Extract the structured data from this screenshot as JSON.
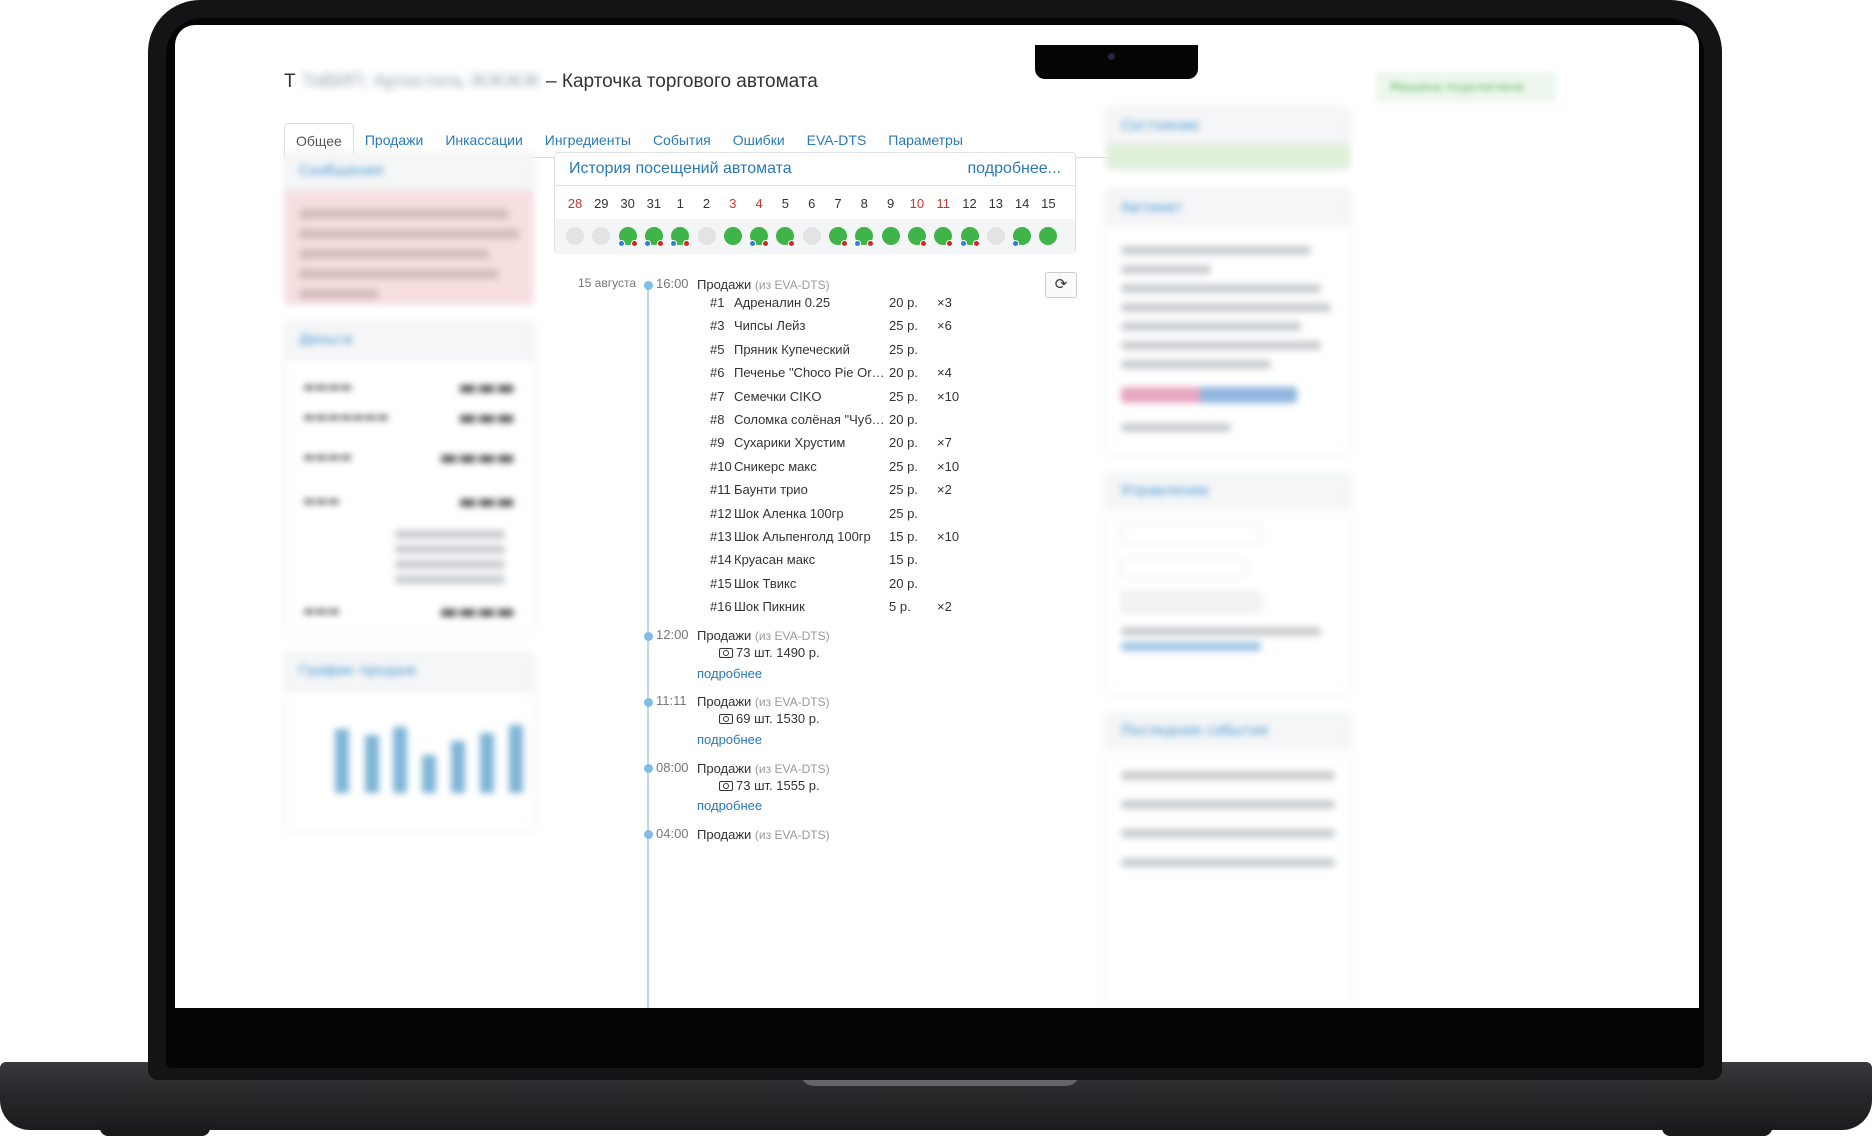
{
  "page": {
    "title_prefix": "Т",
    "title_obscured": "ТиВИП: Артистель ЖЖЖЖ",
    "title_suffix": "– Карточка торгового автомата",
    "header_button": "Машина подключена"
  },
  "tabs": [
    "Общее",
    "Продажи",
    "Инкассации",
    "Ингредиенты",
    "События",
    "Ошибки",
    "EVA-DTS",
    "Параметры"
  ],
  "history": {
    "title": "История посещений автомата",
    "more_link": "подробнее...",
    "days": [
      {
        "label": "28",
        "weekend": true,
        "state": "empty"
      },
      {
        "label": "29",
        "weekend": false,
        "state": "empty"
      },
      {
        "label": "30",
        "weekend": false,
        "state": "both"
      },
      {
        "label": "31",
        "weekend": false,
        "state": "both"
      },
      {
        "label": "1",
        "weekend": false,
        "state": "both"
      },
      {
        "label": "2",
        "weekend": false,
        "state": "empty"
      },
      {
        "label": "3",
        "weekend": true,
        "state": "green"
      },
      {
        "label": "4",
        "weekend": true,
        "state": "both"
      },
      {
        "label": "5",
        "weekend": false,
        "state": "red"
      },
      {
        "label": "6",
        "weekend": false,
        "state": "empty"
      },
      {
        "label": "7",
        "weekend": false,
        "state": "red"
      },
      {
        "label": "8",
        "weekend": false,
        "state": "both"
      },
      {
        "label": "9",
        "weekend": false,
        "state": "green"
      },
      {
        "label": "10",
        "weekend": true,
        "state": "red"
      },
      {
        "label": "11",
        "weekend": true,
        "state": "red"
      },
      {
        "label": "12",
        "weekend": false,
        "state": "both"
      },
      {
        "label": "13",
        "weekend": false,
        "state": "empty"
      },
      {
        "label": "14",
        "weekend": false,
        "state": "blue"
      },
      {
        "label": "15",
        "weekend": false,
        "state": "green"
      }
    ]
  },
  "timeline": {
    "date_label": "15 августа",
    "events": [
      {
        "time": "16:00",
        "title": "Продажи",
        "source": "(из EVA-DTS)"
      },
      {
        "time": "12:00",
        "title": "Продажи",
        "source": "(из EVA-DTS)",
        "summary": "73 шт. 1490 р.",
        "more": "подробнее"
      },
      {
        "time": "11:11",
        "title": "Продажи",
        "source": "(из EVA-DTS)",
        "summary": "69 шт. 1530 р.",
        "more": "подробнее"
      },
      {
        "time": "08:00",
        "title": "Продажи",
        "source": "(из EVA-DTS)",
        "summary": "73 шт. 1555 р.",
        "more": "подробнее"
      },
      {
        "time": "04:00",
        "title": "Продажи",
        "source": "(из EVA-DTS)"
      }
    ],
    "items": [
      {
        "num": "#1",
        "name": "Адреналин 0.25",
        "price": "20 р.",
        "qty": "×3"
      },
      {
        "num": "#3",
        "name": "Чипсы Лейз",
        "price": "25 р.",
        "qty": "×6"
      },
      {
        "num": "#5",
        "name": "Пряник Купеческий",
        "price": "25 р.",
        "qty": ""
      },
      {
        "num": "#6",
        "name": "Печенье \"Choco Pie Origi...",
        "price": "20 р.",
        "qty": "×4"
      },
      {
        "num": "#7",
        "name": "Семечки CIKO",
        "price": "25 р.",
        "qty": "×10"
      },
      {
        "num": "#8",
        "name": "Соломка солёная \"Чубук...",
        "price": "20 р.",
        "qty": ""
      },
      {
        "num": "#9",
        "name": "Сухарики Хрустим",
        "price": "20 р.",
        "qty": "×7"
      },
      {
        "num": "#10",
        "name": "Сникерс макс",
        "price": "25 р.",
        "qty": "×10"
      },
      {
        "num": "#11",
        "name": "Баунти трио",
        "price": "25 р.",
        "qty": "×2"
      },
      {
        "num": "#12",
        "name": "Шок Аленка 100гр",
        "price": "25 р.",
        "qty": ""
      },
      {
        "num": "#13",
        "name": "Шок Альпенголд 100гр",
        "price": "15 р.",
        "qty": "×10"
      },
      {
        "num": "#14",
        "name": "Круасан макс",
        "price": "15 р.",
        "qty": ""
      },
      {
        "num": "#15",
        "name": "Шок Твикс",
        "price": "20 р.",
        "qty": ""
      },
      {
        "num": "#16",
        "name": "Шок Пикник",
        "price": "5 р.",
        "qty": "×2"
      }
    ]
  },
  "left": {
    "messages_title": "Сообщения",
    "money_title": "Деньги",
    "chart_title": "График продаж"
  },
  "right": {
    "status_title": "Состояние",
    "machine_title": "Автомат",
    "control_title": "Управление",
    "events_title": "Последние события"
  },
  "colors": {
    "link": "#2a7ab5",
    "weekend": "#c0392b",
    "visit": "#3fb549",
    "danger_bg": "#f7dfe0",
    "ok_bg": "#dff0d8"
  }
}
